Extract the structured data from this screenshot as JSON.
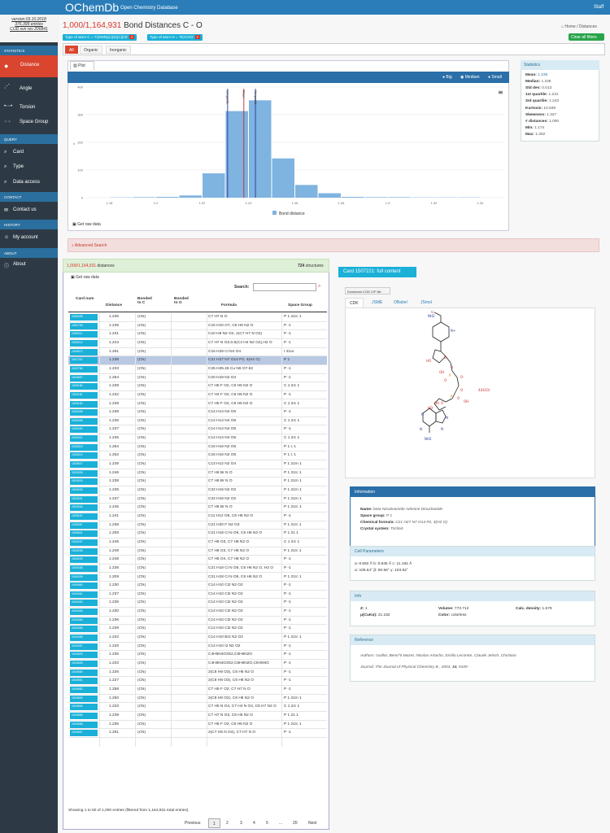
{
  "header": {
    "brand": "OChemDb",
    "brand_sub": "Open Chemistry Database",
    "staff": "Staff"
  },
  "sidebar": {
    "version_lines": [
      "version:03.10.2018",
      "376,399 entries",
      "COD svn rev 206841"
    ],
    "sections": {
      "statistics": "STATISTICS",
      "query": "QUERY",
      "contact": "CONTACT",
      "history": "HISTORY",
      "about": "ABOUT"
    },
    "items": {
      "distance": "Distance",
      "angle": "Angle",
      "torsion": "Torsion",
      "space_group": "Space Group",
      "card": "Card",
      "type": "Type",
      "data_access": "Data access",
      "contact_us": "Contact us",
      "my_account": "My account",
      "about": "About"
    }
  },
  "breadcrumb": {
    "home": "Home",
    "sep": "/",
    "current": "Distances"
  },
  "page": {
    "count": "1,000/1,164,931",
    "title": "Bond Distances C - O"
  },
  "filters": [
    "Type of atom C = 'C(NNN)(c)(S)(C)(O)'",
    "Type of atom O = 'O(CCN)'"
  ],
  "clear_all": "Clear all filters",
  "category_tabs": [
    "All",
    "Organic",
    "Inorganic"
  ],
  "plot": {
    "tab": "Plot",
    "sizes": [
      "Big",
      "Medium",
      "Small"
    ],
    "menu_icon": "hamburger-icon",
    "get_raw": "Get raw data",
    "markers": [
      "1st quartile",
      "Mean",
      "3rd quartile"
    ]
  },
  "chart_data": {
    "type": "bar",
    "x": [
      1.175,
      1.185,
      1.195,
      1.205,
      1.215,
      1.225,
      1.235,
      1.245,
      1.255,
      1.265,
      1.275,
      1.285,
      1.295,
      1.305,
      1.315,
      1.325,
      1.335,
      1.345
    ],
    "values": [
      0,
      1,
      2,
      3,
      8,
      88,
      313,
      352,
      142,
      46,
      16,
      3,
      2,
      2,
      1,
      1,
      1,
      0
    ],
    "x_ticks": [
      "1.18",
      "1.2",
      "1.22",
      "1.24",
      "1.26",
      "1.28",
      "1.3",
      "1.32",
      "1.34"
    ],
    "y_ticks": [
      "0",
      "100",
      "200",
      "300",
      "400"
    ],
    "xlim": [
      1.17,
      1.35
    ],
    "ylim": [
      0,
      400
    ],
    "legend": "Bond distance",
    "legend_position": "bottom",
    "lines": {
      "q1": 1.231,
      "mean": 1.238,
      "q3": 1.243
    },
    "line_colors": {
      "q1": "#2a3a9c",
      "mean": "#c62828",
      "q3": "#2a3a9c"
    },
    "bar_color": "#7fb3e0",
    "ylabel": "n"
  },
  "stats": {
    "title": "Statistics",
    "items": [
      {
        "label": "Mean:",
        "value": "1.238"
      },
      {
        "label": "Median:",
        "value": "1.236"
      },
      {
        "label": "Std dev:",
        "value": "0.013"
      },
      {
        "label": "1st quartile:",
        "value": "1.231"
      },
      {
        "label": "3rd quartile:",
        "value": "1.243"
      },
      {
        "label": "Kurtosis:",
        "value": "10.839"
      },
      {
        "label": "Skewness:",
        "value": "1.327"
      },
      {
        "label": "# distances:",
        "value": "1,000"
      },
      {
        "label": "Min:",
        "value": "1.174"
      },
      {
        "label": "Max:",
        "value": "1.352"
      }
    ]
  },
  "advanced_search": "Advanced Search",
  "table": {
    "count": "1,000/1,164,931",
    "count_suffix": "distances",
    "structures": "724",
    "structures_suffix": "structures",
    "get_raw": "Get raw data",
    "search_label": "Search:",
    "columns": [
      "Card num",
      "Distance",
      "Bonded to C",
      "Bonded to O",
      "Formula",
      "Space Group"
    ],
    "rows": [
      [
        "1500005",
        "1.236",
        "(CN)",
        "",
        "C7 H7 N O",
        "P 1 21/c 1"
      ],
      [
        "1501709",
        "1.235",
        "(CN)",
        "",
        "C15 H10 O7, C6 H6 N2 O",
        "P -1"
      ],
      [
        "1505211",
        "1.231",
        "(CN)",
        "",
        "C10 H8 N2 O2, 2(C7 H7 N O2)",
        "P -1"
      ],
      [
        "1505212",
        "1.244",
        "(CN)",
        "",
        "C7 H7 N O2,0.5(C4 H4 N2 O2),H2 O",
        "P -1"
      ],
      [
        "1505672",
        "1.251",
        "(CN)",
        "",
        "C16 H29 Cl N4 O4",
        "I 41/a"
      ],
      [
        "1507221",
        "1.238",
        "(CN)",
        "",
        "C21 H27 N7 O14 P2, 4(H2 O)",
        "P 1"
      ],
      [
        "1522784",
        "1.233",
        "(CN)",
        "",
        "C25 H25.26 Cu N6 O7.63",
        "P -1"
      ],
      [
        "1525607",
        "1.254",
        "(CN)",
        "",
        "C20 H18 N2 O4",
        "P -1"
      ],
      [
        "1526180",
        "1.239",
        "(CN)",
        "",
        "C7 H5 F O2, C6 H6 N2 O",
        "C 1 2/c 1"
      ],
      [
        "1526181",
        "1.232",
        "(CN)",
        "",
        "C7 H4 F O2, C6 H6 N2 O",
        "P -1"
      ],
      [
        "1526182",
        "1.239",
        "(CN)",
        "",
        "C7 H5 F O2, C6 H6 N2 O",
        "C 1 2/c 1"
      ],
      [
        "1526398",
        "1.238",
        "(CN)",
        "",
        "C14 H14 N4 O6",
        "P -1"
      ],
      [
        "1526399",
        "1.236",
        "(CN)",
        "",
        "C14 H14 N4 O6",
        "C 1 2/c 1"
      ],
      [
        "1526400",
        "1.237",
        "(CN)",
        "",
        "C14 H14 N4 O6",
        "P -1"
      ],
      [
        "1526401",
        "1.235",
        "(CN)",
        "",
        "C14 H14 N4 O6",
        "C 1 2/c 1"
      ],
      [
        "1528318",
        "1.264",
        "(CN)",
        "",
        "C16 H16 N2 O5",
        "P 1 c 1"
      ],
      [
        "1528319",
        "1.262",
        "(CN)",
        "",
        "C16 H16 N2 O5",
        "P 1 c 1"
      ],
      [
        "1528627",
        "1.239",
        "(CN)",
        "",
        "C13 H12 N2 O4",
        "P 1 21/n 1"
      ],
      [
        "1529028",
        "1.246",
        "(CN)",
        "",
        "C7 H6 Br N O",
        "P 1 21/c 1"
      ],
      [
        "1529029",
        "1.238",
        "(CN)",
        "",
        "C7 H6 Br N O",
        "P 1 21/n 1"
      ],
      [
        "1529030",
        "1.236",
        "(CN)",
        "",
        "C22 H16 N2 O2",
        "P 1 21/n 1"
      ],
      [
        "1529031",
        "1.237",
        "(CN)",
        "",
        "C22 H16 N2 O2",
        "P 1 21/n 1"
      ],
      [
        "1529034",
        "1.245",
        "(CN)",
        "",
        "C7 H6 Br N O",
        "P 1 21/c 1"
      ],
      [
        "1535119",
        "1.241",
        "(CN)",
        "",
        "C11 H12 O5, C6 H6 N2 O",
        "P -1"
      ],
      [
        "1535267",
        "1.238",
        "(CN)",
        "",
        "C21 H20 F N2 O3",
        "P 1 21/c 1"
      ],
      [
        "1536841",
        "1.208",
        "(CN)",
        "",
        "C21 H18 Cl N O6, C6 H6 N2 O",
        "P 1 21 1"
      ],
      [
        "1540207",
        "1.246",
        "(CN)",
        "",
        "C7 H6 O3, C7 H8 N2 O",
        "C 1 2/c 1"
      ],
      [
        "1540208",
        "1.248",
        "(CN)",
        "",
        "C7 H6 O3, C7 H8 N2 O",
        "P 1 21/c 1"
      ],
      [
        "1540209",
        "1.248",
        "(CN)",
        "",
        "C7 H6 O4, C7 H8 N2 O",
        "P -1"
      ],
      [
        "1540338",
        "1.238",
        "(CN)",
        "",
        "C21 H18 Cl N O6, C6 H6 N2 O, H2 O",
        "P -1"
      ],
      [
        "1540339",
        "1.209",
        "(CN)",
        "",
        "C21 H18 Cl N O6, C6 H6 N2 O",
        "P 1 21/c 1"
      ],
      [
        "1540460",
        "1.230",
        "(CN)",
        "",
        "C14 H10 Cl2 N2 O2",
        "P -1"
      ],
      [
        "1540461",
        "1.237",
        "(CN)",
        "",
        "C14 H10 Cl2 N2 O2",
        "P -1"
      ],
      [
        "1540462",
        "1.235",
        "(CN)",
        "",
        "C14 H10 Cl2 N2 O2",
        "P -1"
      ],
      [
        "1540463",
        "1.230",
        "(CN)",
        "",
        "C14 H10 Cl2 N2 O2",
        "P -1"
      ],
      [
        "1540464",
        "1.236",
        "(CN)",
        "",
        "C14 H10 Cl2 N2 O2",
        "P -1"
      ],
      [
        "1540465",
        "1.239",
        "(CN)",
        "",
        "C14 H10 Cl2 N2 O2",
        "P -1"
      ],
      [
        "1540466",
        "1.222",
        "(CN)",
        "",
        "C14 H10 Br2 N2 O2",
        "P 1 21/c 1"
      ],
      [
        "1540467",
        "1.226",
        "(CN)",
        "",
        "C14 H10 I2 N2 O2",
        "P -1"
      ],
      [
        "1540625",
        "1.235",
        "(CN)",
        "",
        "C4H6N4O3S2,C6H6N2O",
        "P -1"
      ],
      [
        "1540626",
        "1.233",
        "(CN)",
        "",
        "C4H6N4O3S2,C6H6N2O,C5H5NO",
        "P -1"
      ],
      [
        "1540660",
        "1.226",
        "(CN)",
        "",
        "2(C8 H8 O3), C6 H6 N2 O",
        "P -1"
      ],
      [
        "1540661",
        "1.227",
        "(CN)",
        "",
        "2(C8 H8 O3), C6 H6 N2 O",
        "P -1"
      ],
      [
        "1540662",
        "1.258",
        "(CN)",
        "",
        "C7 H5 F O2, C7 H7 N O",
        "P -1"
      ],
      [
        "1540663",
        "1.250",
        "(CN)",
        "",
        "2(C8 H8 O2), C6 H6 N2 O",
        "P 1 21/n 1"
      ],
      [
        "1540664",
        "1.233",
        "(CN)",
        "",
        "C7 H5 N O4, C7 H4 N O4, C6 H7 N2 O",
        "C 1 2/c 1"
      ],
      [
        "1540665",
        "1.238",
        "(CN)",
        "",
        "C7 H7 N O2, C6 H6 N2 O",
        "P 1 21 1"
      ],
      [
        "1540666",
        "1.235",
        "(CN)",
        "",
        "C7 H5 F O2, C6 H6 N2 O",
        "P 1 21/c 1"
      ],
      [
        "1540667",
        "1.251",
        "(CN)",
        "",
        "2(C7 H5 N O4), C7 H7 N O",
        "P -1"
      ]
    ],
    "footer": "Showing 1 to 50 of 1,000 entries (filtered from 1,164,931 total entries)",
    "pagination": [
      "Previous",
      "1",
      "2",
      "3",
      "4",
      "5",
      "...",
      "20",
      "Next"
    ]
  },
  "card": {
    "title": "Card 1507221: full content",
    "download": "Download COD CIF file",
    "viewer_tabs": [
      "CDK",
      "JSME",
      "OBabel",
      "JSmol"
    ],
    "info_title": "Information",
    "name_label": "Name:",
    "name_value": "beta-Nicotinamide Adenine Dinucleotide",
    "sg_label": "Space group:",
    "sg_value": "P 1",
    "formula_label": "Chemical formula:",
    "formula_value": "C21 H27 N7 O14 P2, 4(H2 O)",
    "crystal_label": "Crystal system:",
    "crystal_value": "Triclinic",
    "cell_title": "Cell Parameters",
    "cell_line1": "a: 8.592 Å b: 8.845 Å c: 11.192 Å",
    "cell_line2": "α: 109.64° β: 90.56° γ: 103.92°",
    "info2_title": "Info",
    "z_label": "Z:",
    "z_value": "1",
    "mu_label": "μ(CuKα):",
    "mu_value": "21.182",
    "vol_label": "Volume:",
    "vol_value": "773.712",
    "color_label": "Color:",
    "color_value": "colorless",
    "dens_label": "Calc. density:",
    "dens_value": "1.579",
    "ref_title": "Reference",
    "authors": "Authors: Guillot, Beno^it Muzet, Nicolas Artacho, Emilio Lecomte, Claude Jelsch, Christian",
    "journal_pre": "Journal: The Journal of Physical Chemistry B , 2003, ",
    "journal_vol": "34",
    "journal_post": ", 9109 -",
    "mol_labels": [
      "NH2",
      "O",
      "N+",
      "O",
      "HO",
      "OH",
      "O",
      "P",
      "O",
      "O-",
      "O",
      "P",
      "O",
      "OH",
      "4(H2O)",
      "HO",
      "OH",
      "O",
      "N",
      "N",
      "N",
      "N",
      "NH2"
    ]
  }
}
